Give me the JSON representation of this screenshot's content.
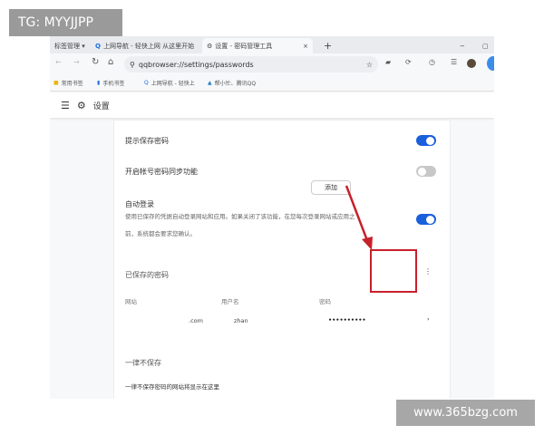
{
  "overlay": {
    "tg": "TG: MYYJJPP",
    "site": "www.365bzg.com"
  },
  "tabbar": {
    "bookmark_mgr": "标签管理 ▾",
    "tab1": "上网导航 - 轻快上网 从这里开始",
    "tab2": "设置 - 密码管理工具",
    "close": "×",
    "new_tab": "+",
    "minimize": "−",
    "maximize": "▢"
  },
  "toolbar": {
    "url": "qqbrowser://settings/passwords"
  },
  "bookmarks": [
    "常用书签",
    "手机书签",
    "上网导航 - 轻快上",
    "帮小忙、腾讯QQ"
  ],
  "settings": {
    "title": "设置"
  },
  "content": {
    "prompt_save": {
      "label": "提示保存密码",
      "enabled": true
    },
    "sync": {
      "label": "开启帐号密码同步功能",
      "enabled": false
    },
    "auto_login": {
      "label": "自动登录",
      "desc1": "使用已保存的凭据自动登录网站和应用。如果关闭了该功能，在您每次登录网站或应用之",
      "desc2": "前，系统都会要求您确认。",
      "enabled": true
    },
    "saved": {
      "title": "已保存的密码",
      "add": "添加",
      "more": "⋮",
      "col_site": "网站",
      "col_user": "用户名",
      "col_pass": "密码",
      "rows": [
        {
          "site": ".com",
          "user": "zhan",
          "password": "••••••••••",
          "chevron": "›"
        }
      ]
    },
    "never": {
      "title": "一律不保存",
      "empty": "一律不保存密码的网站将显示在这里"
    }
  },
  "colors": {
    "accent": "#1a5fdc",
    "highlight": "#c8202a"
  }
}
